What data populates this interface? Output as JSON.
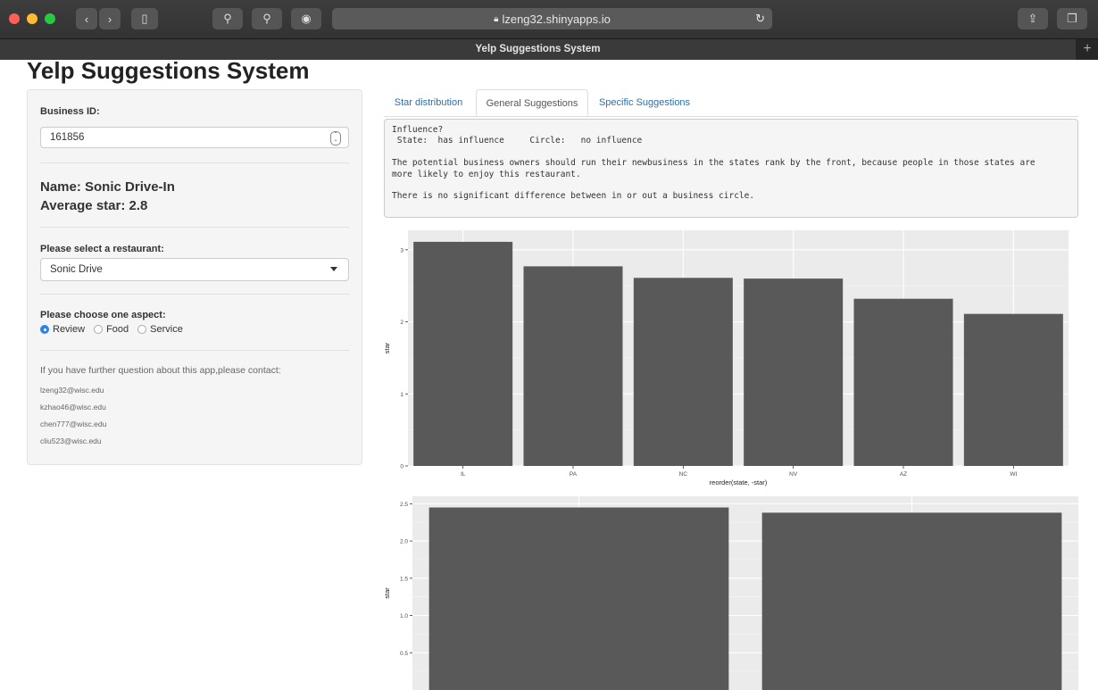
{
  "browser": {
    "url": "lzeng32.shinyapps.io",
    "tab_title": "Yelp Suggestions System"
  },
  "page": {
    "title": "Yelp Suggestions System"
  },
  "sidebar": {
    "business_id_label": "Business ID:",
    "business_id_value": "161856",
    "name_line": "Name: Sonic Drive-In",
    "avg_star_line": "Average star: 2.8",
    "restaurant_label": "Please select a restaurant:",
    "restaurant_selected": "Sonic Drive",
    "aspect_label": "Please choose one aspect:",
    "aspects": [
      "Review",
      "Food",
      "Service"
    ],
    "aspect_selected": "Review",
    "contact_text": "If you have further question about this app,please contact:",
    "emails": [
      "lzeng32@wisc.edu",
      "kzhao46@wisc.edu",
      "chen777@wisc.edu",
      "cliu523@wisc.edu"
    ]
  },
  "main": {
    "tabs": [
      {
        "label": "Star distribution"
      },
      {
        "label": "General Suggestions"
      },
      {
        "label": "Specific Suggestions"
      }
    ],
    "active_tab": "General Suggestions",
    "output_lines": [
      "Influence?",
      " State:  has influence     Circle:   no influence",
      "",
      "The potential business owners should run their newbusiness in the states rank by the front, because people in those states are",
      "more likely to enjoy this restaurant.",
      "",
      "There is no significant difference between in or out a business circle."
    ]
  },
  "chart_data": [
    {
      "type": "bar",
      "categories": [
        "IL",
        "PA",
        "NC",
        "NV",
        "AZ",
        "WI"
      ],
      "values": [
        3.11,
        2.77,
        2.61,
        2.6,
        2.32,
        2.11
      ],
      "xlabel": "reorder(state, -star)",
      "ylabel": "star",
      "ylim": [
        0,
        3.27
      ],
      "yticks": [
        0,
        1,
        2,
        3
      ],
      "grid": true
    },
    {
      "type": "bar",
      "categories": [
        "",
        ""
      ],
      "values": [
        2.45,
        2.38
      ],
      "ylabel": "star",
      "ylim": [
        0,
        2.6
      ],
      "yticks": [
        "0.5",
        "1.0",
        "1.5",
        "2.0",
        "2.5"
      ],
      "grid": true
    }
  ],
  "colors": {
    "bar": "#595959",
    "panel": "#ebebeb",
    "accent": "#2f83e8",
    "link": "#2a6fb0"
  }
}
